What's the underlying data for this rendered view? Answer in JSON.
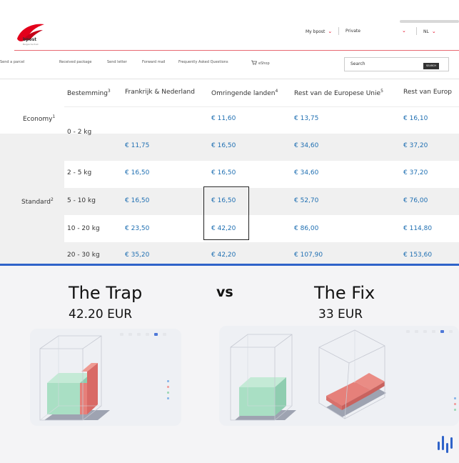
{
  "header": {
    "logo_text": "bpost",
    "logo_subtext": "Belgische Post",
    "mybpost_label": "My bpost",
    "private_label": "Private",
    "language": "NL",
    "chevron": "⌄"
  },
  "nav": {
    "items": [
      "Send a parcel",
      "Received package",
      "Send letter",
      "Forward mail",
      "Frequently Asked Questions",
      "eShop"
    ],
    "search_placeholder": "Search",
    "search_button": "SEARCH"
  },
  "table": {
    "headers": [
      {
        "text": "Bestemming",
        "sup": "3"
      },
      {
        "text": "Frankrijk & Nederland",
        "sup": ""
      },
      {
        "text": "Omringende landen",
        "sup": "4"
      },
      {
        "text": "Rest van de Europese Unie",
        "sup": "5"
      },
      {
        "text": "Rest van Europ",
        "sup": ""
      }
    ],
    "services": [
      {
        "label": "Economy",
        "sup": "1"
      },
      {
        "label": "Standard",
        "sup": "2"
      }
    ],
    "rows": [
      {
        "weight": "0 - 2 kg",
        "fr_nl": "",
        "omr": "€ 11,60",
        "eu": "€ 13,75",
        "rest": "€ 16,10"
      },
      {
        "weight": "",
        "fr_nl": "€ 11,75",
        "omr": "€ 16,50",
        "eu": "€ 34,60",
        "rest": "€ 37,20"
      },
      {
        "weight": "2 - 5 kg",
        "fr_nl": "€ 16,50",
        "omr": "€ 16,50",
        "eu": "€ 34,60",
        "rest": "€ 37,20"
      },
      {
        "weight": "5 - 10 kg",
        "fr_nl": "€ 16,50",
        "omr": "€ 16,50",
        "eu": "€ 52,70",
        "rest": "€ 76,00"
      },
      {
        "weight": "10 - 20 kg",
        "fr_nl": "€ 23,50",
        "omr": "€ 42,20",
        "eu": "€ 86,00",
        "rest": "€ 114,80"
      },
      {
        "weight": "20 - 30 kg",
        "fr_nl": "€ 35,20",
        "omr": "€ 42,20",
        "eu": "€ 107,90",
        "rest": "€ 153,60"
      }
    ]
  },
  "comparison": {
    "left_title": "The Trap",
    "left_price": "42.20  EUR",
    "vs": "vs",
    "right_title": "The Fix",
    "right_price": "33  EUR"
  },
  "colors": {
    "brand_red": "#e3001b",
    "price_blue": "#1f6fb2",
    "divider_blue": "#2f63c9",
    "box_green": "#a9dfc4",
    "box_red": "#e6807a"
  }
}
